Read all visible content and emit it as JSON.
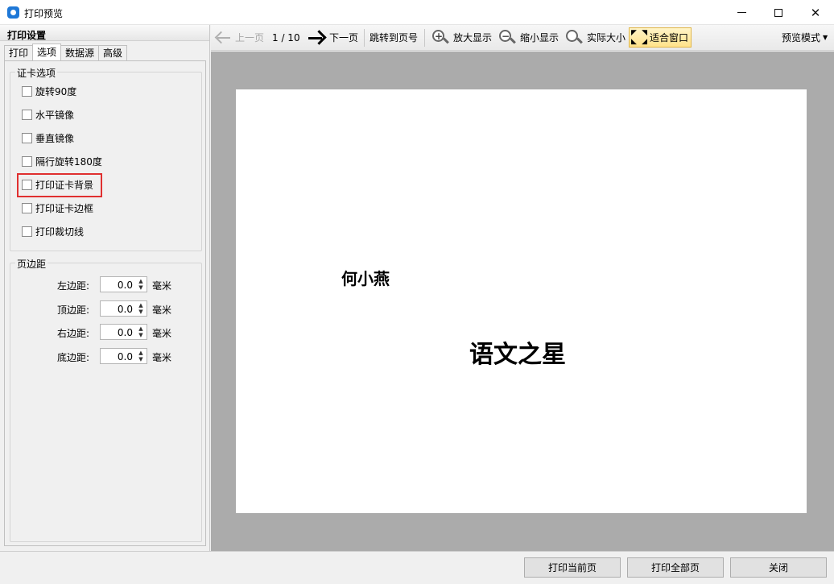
{
  "window": {
    "title": "打印预览"
  },
  "left_panel": {
    "title": "打印设置",
    "tabs": [
      "打印",
      "选项",
      "数据源",
      "高级"
    ],
    "active_tab": "选项",
    "card_options": {
      "legend": "证卡选项",
      "items": [
        {
          "label": "旋转90度",
          "checked": false
        },
        {
          "label": "水平镜像",
          "checked": false
        },
        {
          "label": "垂直镜像",
          "checked": false
        },
        {
          "label": "隔行旋转180度",
          "checked": false
        },
        {
          "label": "打印证卡背景",
          "checked": false,
          "highlighted": true
        },
        {
          "label": "打印证卡边框",
          "checked": false
        },
        {
          "label": "打印裁切线",
          "checked": false
        }
      ]
    },
    "margins": {
      "legend": "页边距",
      "unit": "毫米",
      "rows": [
        {
          "label": "左边距:",
          "value": "0.0"
        },
        {
          "label": "顶边距:",
          "value": "0.0"
        },
        {
          "label": "右边距:",
          "value": "0.0"
        },
        {
          "label": "底边距:",
          "value": "0.0"
        }
      ]
    }
  },
  "toolbar": {
    "prev_page": "上一页",
    "page_indicator": "1 / 10",
    "next_page": "下一页",
    "jump_to_page": "跳转到页号",
    "zoom_in": "放大显示",
    "zoom_out": "缩小显示",
    "actual_size": "实际大小",
    "fit_window": "适合窗口",
    "preview_mode": "预览模式"
  },
  "preview": {
    "name": "何小燕",
    "award": "语文之星"
  },
  "buttons": {
    "print_current": "打印当前页",
    "print_all": "打印全部页",
    "close": "关闭"
  },
  "colors": {
    "highlight_border": "#e03030",
    "preview_background": "#ababab",
    "fit_button_active": "#ffe28a"
  },
  "icons": {
    "prev": "arrow-left-icon",
    "next": "arrow-right-icon",
    "zoom_in": "zoom-in-icon",
    "zoom_out": "zoom-out-icon",
    "actual_size": "magnifier-icon",
    "fit": "fit-window-icon"
  }
}
